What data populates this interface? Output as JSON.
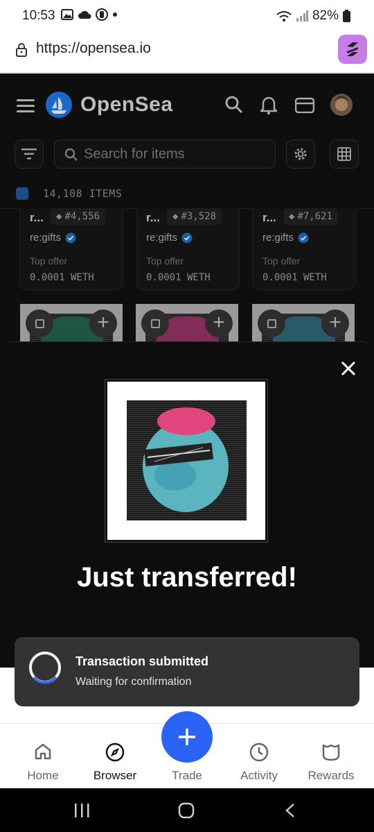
{
  "status_bar": {
    "time": "10:53",
    "battery": "82%"
  },
  "browser": {
    "url": "https://opensea.io"
  },
  "app_header": {
    "brand": "OpenSea"
  },
  "search": {
    "placeholder": "Search for items"
  },
  "items": {
    "count_label": "14,108 ITEMS"
  },
  "cards": [
    {
      "name": "r...",
      "token": "#4,556",
      "collection": "re:gifts",
      "offer_label": "Top offer",
      "offer_value": "0.0001 WETH"
    },
    {
      "name": "r...",
      "token": "#3,528",
      "collection": "re:gifts",
      "offer_label": "Top offer",
      "offer_value": "0.0001 WETH"
    },
    {
      "name": "r...",
      "token": "#7,621",
      "collection": "re:gifts",
      "offer_label": "Top offer",
      "offer_value": "0.0001 WETH"
    }
  ],
  "sheet": {
    "title": "Just transferred!"
  },
  "toast": {
    "title": "Transaction submitted",
    "subtitle": "Waiting for confirmation"
  },
  "bottom_nav": {
    "items": [
      {
        "label": "Home",
        "icon": "home-icon"
      },
      {
        "label": "Browser",
        "icon": "compass-icon"
      },
      {
        "label": "Trade",
        "icon": "plus-icon"
      },
      {
        "label": "Activity",
        "icon": "clock-icon"
      },
      {
        "label": "Rewards",
        "icon": "rewards-icon"
      }
    ],
    "active": "Browser"
  },
  "colors": {
    "accent": "#2b63f5",
    "brand_blue": "#2081e2",
    "extension": "#c77de6"
  }
}
